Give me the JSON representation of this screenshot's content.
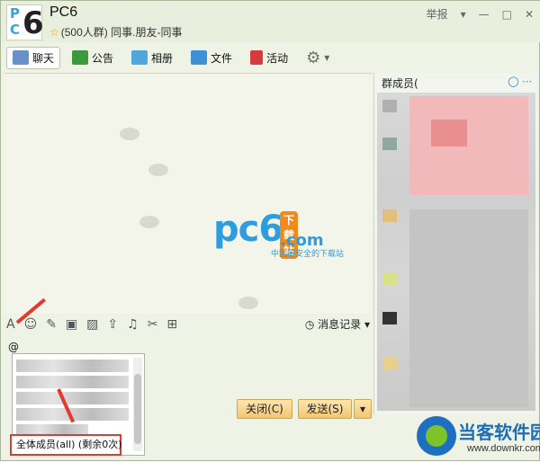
{
  "window": {
    "group_name": "PC6",
    "group_sub": "(500人群) 同事.朋友-同事",
    "report_label": "举报"
  },
  "tabs": [
    {
      "label": "聊天",
      "icon": "chat-icon"
    },
    {
      "label": "公告",
      "icon": "megaphone-icon"
    },
    {
      "label": "相册",
      "icon": "photo-icon"
    },
    {
      "label": "文件",
      "icon": "folder-icon"
    },
    {
      "label": "活动",
      "icon": "flag-icon"
    }
  ],
  "logo": {
    "big": "pc6",
    "download": "下载站",
    "com": ".com",
    "slogan": "中国最安全的下载站"
  },
  "toolbar": {
    "history_label": "消息记录"
  },
  "input": {
    "text": "@"
  },
  "popup": {
    "all_members_label": "全体成员(all) (剩余0次)"
  },
  "buttons": {
    "close_label": "关闭(C)",
    "send_label": "发送(S)"
  },
  "members": {
    "header_label": "群成员("
  },
  "watermark": {
    "title": "当客软件园",
    "url": "www.downkr.com"
  },
  "colors": {
    "accent": "#2d9de0",
    "highlight": "#e23b2e",
    "button": "#f3c66b"
  }
}
